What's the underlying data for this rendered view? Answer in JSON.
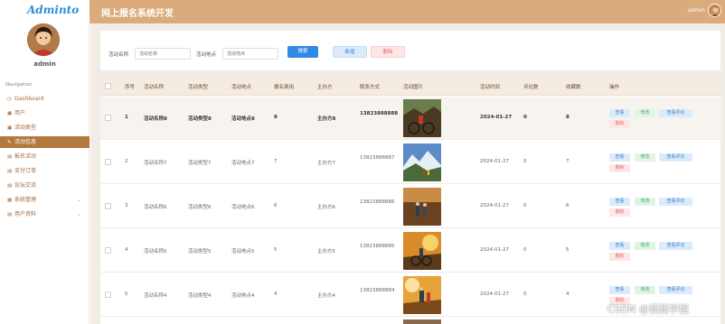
{
  "header": {
    "logo": "Adminto",
    "system_title": "网上报名系统开发",
    "username": "admin"
  },
  "sidebar": {
    "username": "admin",
    "nav_heading": "Navigation",
    "items": [
      {
        "label": "Dashboard",
        "icon": "dashboard-icon",
        "active": false,
        "expandable": false
      },
      {
        "label": "用户",
        "icon": "user-icon",
        "active": false,
        "expandable": false
      },
      {
        "label": "活动类型",
        "icon": "tag-icon",
        "active": false,
        "expandable": false
      },
      {
        "label": "活动信息",
        "icon": "info-icon",
        "active": true,
        "expandable": false
      },
      {
        "label": "报名活动",
        "icon": "signup-icon",
        "active": false,
        "expandable": false
      },
      {
        "label": "支付订单",
        "icon": "order-icon",
        "active": false,
        "expandable": false
      },
      {
        "label": "论坛交流",
        "icon": "forum-icon",
        "active": false,
        "expandable": false
      },
      {
        "label": "系统管理",
        "icon": "system-icon",
        "active": false,
        "expandable": true
      },
      {
        "label": "用户资料",
        "icon": "profile-icon",
        "active": false,
        "expandable": true
      }
    ]
  },
  "search": {
    "name_label": "活动名称",
    "name_placeholder": "活动名称",
    "place_label": "活动地点",
    "place_placeholder": "活动地点",
    "search_button": "搜索",
    "add_button": "新增",
    "delete_button": "删除"
  },
  "table": {
    "columns": [
      "序号",
      "活动名称",
      "活动类型",
      "活动地点",
      "报名费用",
      "主办方",
      "联系方式",
      "活动图片",
      "活动时间",
      "评论数",
      "收藏数",
      "操作"
    ],
    "rows": [
      {
        "index": "1",
        "name": "活动名称8",
        "type": "活动类型8",
        "place": "活动地点8",
        "fee": "8",
        "host": "主办方8",
        "phone": "13823888888",
        "date": "2024-01-27",
        "comments": "0",
        "favorites": "8"
      },
      {
        "index": "2",
        "name": "活动名称7",
        "type": "活动类型7",
        "place": "活动地点7",
        "fee": "7",
        "host": "主办方7",
        "phone": "13823888887",
        "date": "2024-01-27",
        "comments": "0",
        "favorites": "7"
      },
      {
        "index": "3",
        "name": "活动名称6",
        "type": "活动类型6",
        "place": "活动地点6",
        "fee": "6",
        "host": "主办方6",
        "phone": "13823888886",
        "date": "2024-01-27",
        "comments": "0",
        "favorites": "6"
      },
      {
        "index": "4",
        "name": "活动名称5",
        "type": "活动类型5",
        "place": "活动地点5",
        "fee": "5",
        "host": "主办方5",
        "phone": "13823888885",
        "date": "2024-01-27",
        "comments": "0",
        "favorites": "5"
      },
      {
        "index": "5",
        "name": "活动名称4",
        "type": "活动类型4",
        "place": "活动地点4",
        "fee": "4",
        "host": "主办方4",
        "phone": "13823888884",
        "date": "2024-01-27",
        "comments": "0",
        "favorites": "4"
      }
    ],
    "actions": {
      "view": "查看",
      "edit": "修改",
      "view_comments": "查看评论",
      "delete": "删除"
    }
  },
  "watermark": "CSDN @茹茹学姐",
  "colors": {
    "header_bg": "#dbab7c",
    "sidebar_active": "#b3793f",
    "primary": "#2f8ae6",
    "danger": "#ee6666",
    "success": "#4caf6a"
  }
}
